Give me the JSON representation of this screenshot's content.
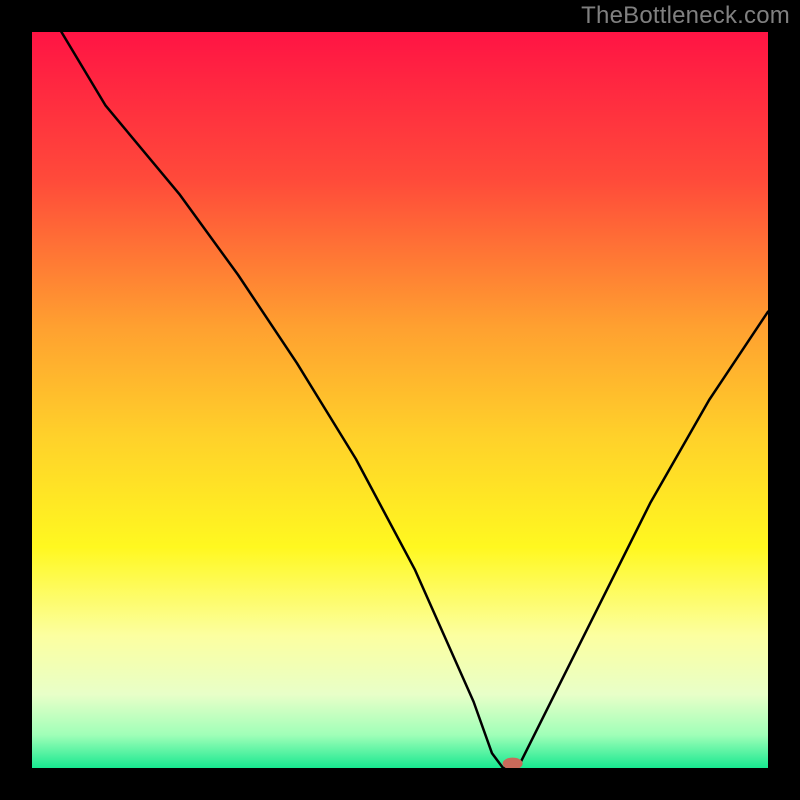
{
  "watermark": "TheBottleneck.com",
  "chart_data": {
    "type": "line",
    "title": "",
    "xlabel": "",
    "ylabel": "",
    "xlim": [
      0,
      100
    ],
    "ylim": [
      0,
      100
    ],
    "gradient_stops": [
      {
        "offset": 0.0,
        "color": "#ff1444"
      },
      {
        "offset": 0.2,
        "color": "#ff4a3a"
      },
      {
        "offset": 0.4,
        "color": "#ffa030"
      },
      {
        "offset": 0.55,
        "color": "#ffd12a"
      },
      {
        "offset": 0.7,
        "color": "#fff820"
      },
      {
        "offset": 0.82,
        "color": "#fcffa0"
      },
      {
        "offset": 0.9,
        "color": "#e8ffc8"
      },
      {
        "offset": 0.955,
        "color": "#a0ffb8"
      },
      {
        "offset": 1.0,
        "color": "#18e890"
      }
    ],
    "series": [
      {
        "name": "bottleneck-curve",
        "x": [
          4,
          10,
          20,
          28,
          36,
          44,
          52,
          56,
          60,
          62.5,
          64,
          65,
          66,
          70,
          76,
          84,
          92,
          100
        ],
        "y": [
          100,
          90,
          78,
          67,
          55,
          42,
          27,
          18,
          9,
          2,
          0,
          0,
          0,
          8,
          20,
          36,
          50,
          62
        ]
      }
    ],
    "marker": {
      "x": 65.3,
      "y": 0,
      "color": "#c86a5a",
      "rx": 10,
      "ry": 6
    }
  }
}
